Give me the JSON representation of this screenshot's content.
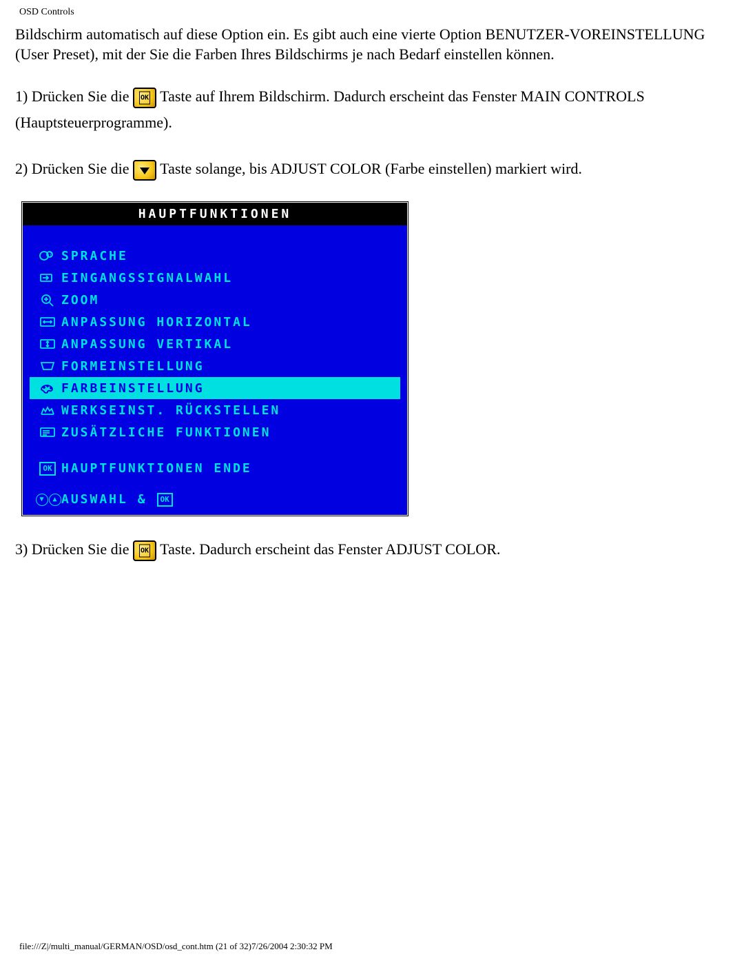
{
  "header": "OSD Controls",
  "intro_paragraph": "Bildschirm automatisch auf diese Option ein. Es gibt auch eine vierte Option BENUTZER-VOREINSTELLUNG (User Preset), mit der Sie die Farben Ihres Bildschirms je nach Bedarf einstellen können.",
  "steps": {
    "s1a": "1) Drücken Sie die ",
    "s1b": " Taste auf Ihrem Bildschirm. Dadurch erscheint das Fenster MAIN CONTROLS (Hauptsteuerprogramme).",
    "s2a": "2) Drücken Sie die ",
    "s2b": " Taste solange, bis ADJUST COLOR (Farbe einstellen) markiert wird.",
    "s3a": "3) Drücken Sie die ",
    "s3b": " Taste. Dadurch erscheint das Fenster ADJUST COLOR."
  },
  "osd": {
    "title": "HAUPTFUNKTIONEN",
    "items": [
      {
        "label": "SPRACHE",
        "highlight": false,
        "icon": "language-icon"
      },
      {
        "label": "EINGANGSSIGNALWAHL",
        "highlight": false,
        "icon": "input-signal-icon"
      },
      {
        "label": "ZOOM",
        "highlight": false,
        "icon": "zoom-icon"
      },
      {
        "label": "ANPASSUNG HORIZONTAL",
        "highlight": false,
        "icon": "horizontal-adjust-icon"
      },
      {
        "label": "ANPASSUNG VERTIKAL",
        "highlight": false,
        "icon": "vertical-adjust-icon"
      },
      {
        "label": "FORMEINSTELLUNG",
        "highlight": false,
        "icon": "shape-adjust-icon"
      },
      {
        "label": "FARBEINSTELLUNG",
        "highlight": true,
        "icon": "color-adjust-icon"
      },
      {
        "label": "WERKSEINST. RÜCKSTELLEN",
        "highlight": false,
        "icon": "factory-reset-icon"
      },
      {
        "label": "ZUSÄTZLICHE FUNKTIONEN",
        "highlight": false,
        "icon": "extra-functions-icon"
      }
    ],
    "ende_label": "HAUPTFUNKTIONEN ENDE",
    "footer_label": "AUSWAHL &",
    "footer_ok": "OK"
  },
  "footer_path": "file:///Z|/multi_manual/GERMAN/OSD/osd_cont.htm (21 of 32)7/26/2004 2:30:32 PM"
}
